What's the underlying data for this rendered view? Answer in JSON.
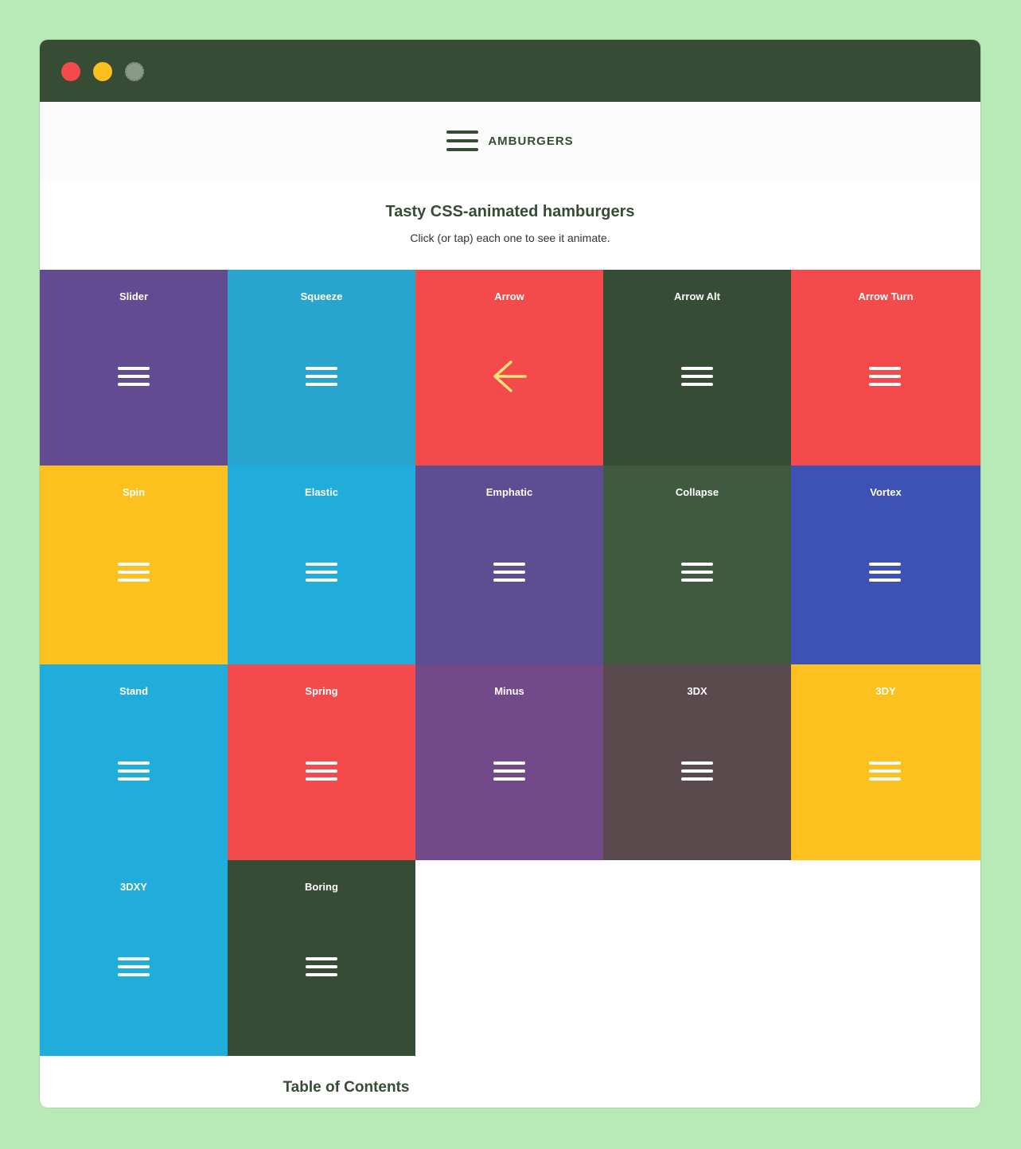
{
  "site": {
    "logo_text": "AMBURGERS"
  },
  "intro": {
    "title": "Tasty CSS-animated hamburgers",
    "subtitle": "Click (or tap) each one to see it animate."
  },
  "tiles": [
    {
      "label": "Slider",
      "color": "#634b91",
      "icon": "hamburger-icon"
    },
    {
      "label": "Squeeze",
      "color": "#29a4cf",
      "icon": "hamburger-icon"
    },
    {
      "label": "Arrow",
      "color": "#f44a4b",
      "icon": "arrow-left-icon"
    },
    {
      "label": "Arrow Alt",
      "color": "#364c35",
      "icon": "hamburger-icon"
    },
    {
      "label": "Arrow Turn",
      "color": "#f44a4b",
      "icon": "hamburger-icon"
    },
    {
      "label": "Spin",
      "color": "#fcc11e",
      "icon": "hamburger-icon"
    },
    {
      "label": "Elastic",
      "color": "#21addb",
      "icon": "hamburger-icon"
    },
    {
      "label": "Emphatic",
      "color": "#5d4d93",
      "icon": "hamburger-icon"
    },
    {
      "label": "Collapse",
      "color": "#3f5a3f",
      "icon": "hamburger-icon"
    },
    {
      "label": "Vortex",
      "color": "#3e51b5",
      "icon": "hamburger-icon"
    },
    {
      "label": "Stand",
      "color": "#21addb",
      "icon": "hamburger-icon"
    },
    {
      "label": "Spring",
      "color": "#f44a4b",
      "icon": "hamburger-icon"
    },
    {
      "label": "Minus",
      "color": "#724a89",
      "icon": "hamburger-icon"
    },
    {
      "label": "3DX",
      "color": "#5a4a4e",
      "icon": "hamburger-icon"
    },
    {
      "label": "3DY",
      "color": "#fcc11e",
      "icon": "hamburger-icon"
    },
    {
      "label": "3DXY",
      "color": "#21addb",
      "icon": "hamburger-icon"
    },
    {
      "label": "Boring",
      "color": "#364c35",
      "icon": "hamburger-icon"
    }
  ],
  "toc": {
    "title": "Table of Contents"
  }
}
